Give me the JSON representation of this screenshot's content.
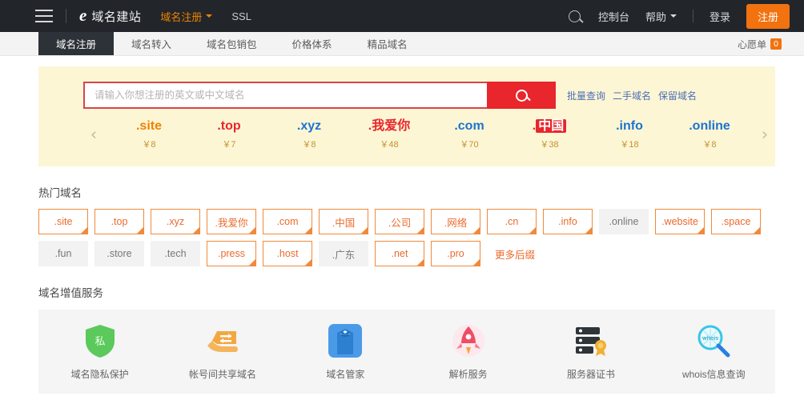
{
  "topnav": {
    "menu_icon": "hamburger-icon",
    "logo_mark": "e",
    "logo_text": "域名建站",
    "items": [
      {
        "label": "域名注册",
        "active": true,
        "has_caret": true
      },
      {
        "label": "SSL",
        "active": false,
        "has_caret": false
      }
    ],
    "search_icon": "search-icon",
    "console_label": "控制台",
    "help_label": "帮助",
    "login_label": "登录",
    "register_label": "注册",
    "accent_color": "#ef8200",
    "register_bg": "#f1720f"
  },
  "tabbar": {
    "tabs": [
      {
        "label": "域名注册",
        "active": true
      },
      {
        "label": "域名转入",
        "active": false
      },
      {
        "label": "域名包销包",
        "active": false
      },
      {
        "label": "价格体系",
        "active": false
      },
      {
        "label": "精品域名",
        "active": false
      }
    ],
    "wishlist_label": "心愿单",
    "wishlist_count": "0"
  },
  "banner": {
    "background": "#fdf6d5",
    "search": {
      "placeholder": "请输入你想注册的英文或中文域名",
      "value": "",
      "button_icon": "search-icon",
      "button_color": "#e8262c",
      "border_color": "#d9434a"
    },
    "links": [
      "批量查询",
      "二手域名",
      "保留域名"
    ],
    "carousel": {
      "prev_icon": "chevron-left-icon",
      "next_icon": "chevron-right-icon",
      "items": [
        {
          "name": ".site",
          "price": "￥8",
          "color": "#ef8200",
          "boxed": false
        },
        {
          "name": ".top",
          "price": "￥7",
          "color": "#e8262c",
          "boxed": false
        },
        {
          "name": ".xyz",
          "price": "￥8",
          "color": "#1a74d0",
          "boxed": false
        },
        {
          "name": ".我爱你",
          "price": "￥48",
          "color": "#e8262c",
          "boxed": false
        },
        {
          "name": ".com",
          "price": "￥70",
          "color": "#1a74d0",
          "boxed": false
        },
        {
          "name": ".中国",
          "price": "￥38",
          "color": "#e8262c",
          "boxed": true
        },
        {
          "name": ".info",
          "price": "￥18",
          "color": "#1a74d0",
          "boxed": false
        },
        {
          "name": ".online",
          "price": "￥8",
          "color": "#1a74d0",
          "boxed": false
        }
      ]
    }
  },
  "hot_domains": {
    "title": "热门域名",
    "row1": [
      {
        "label": ".site",
        "highlighted": true
      },
      {
        "label": ".top",
        "highlighted": true
      },
      {
        "label": ".xyz",
        "highlighted": true
      },
      {
        "label": ".我爱你",
        "highlighted": true
      },
      {
        "label": ".com",
        "highlighted": true
      },
      {
        "label": ".中国",
        "highlighted": true
      },
      {
        "label": ".公司",
        "highlighted": true
      },
      {
        "label": ".网络",
        "highlighted": true
      },
      {
        "label": ".cn",
        "highlighted": true
      },
      {
        "label": ".info",
        "highlighted": true
      },
      {
        "label": ".online",
        "highlighted": false
      },
      {
        "label": ".website",
        "highlighted": true
      },
      {
        "label": ".space",
        "highlighted": true
      }
    ],
    "row2": [
      {
        "label": ".fun",
        "highlighted": false
      },
      {
        "label": ".store",
        "highlighted": false
      },
      {
        "label": ".tech",
        "highlighted": false
      },
      {
        "label": ".press",
        "highlighted": true
      },
      {
        "label": ".host",
        "highlighted": true
      },
      {
        "label": ".广东",
        "highlighted": false
      },
      {
        "label": ".net",
        "highlighted": true
      },
      {
        "label": ".pro",
        "highlighted": true
      }
    ],
    "more_label": "更多后缀"
  },
  "services": {
    "title": "域名增值服务",
    "items": [
      {
        "label": "域名隐私保护",
        "icon": "shield-privacy-icon",
        "color": "#5bc95b",
        "glyph": "私"
      },
      {
        "label": "帐号间共享域名",
        "icon": "hand-exchange-icon",
        "color": "#f5a33c",
        "glyph": "⇄"
      },
      {
        "label": "域名管家",
        "icon": "tuxedo-butler-icon",
        "color": "#4a9ae8",
        "glyph": ""
      },
      {
        "label": "解析服务",
        "icon": "rocket-icon",
        "color": "#ef4d63",
        "glyph": ""
      },
      {
        "label": "服务器证书",
        "icon": "server-certificate-icon",
        "color": "#2f3438",
        "glyph": ""
      },
      {
        "label": "whois信息查询",
        "icon": "whois-search-icon",
        "color": "#36c6e8",
        "glyph": "whois"
      }
    ]
  }
}
